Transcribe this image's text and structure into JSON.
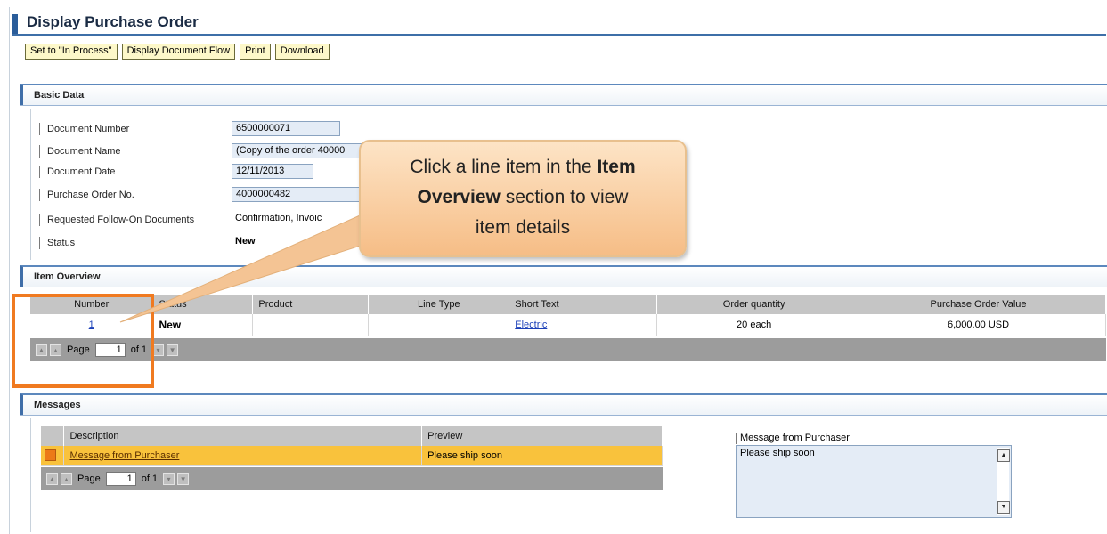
{
  "page": {
    "title": "Display Purchase Order"
  },
  "toolbar": {
    "set_in_process": "Set to \"In Process\"",
    "display_doc_flow": "Display Document Flow",
    "print": "Print",
    "download": "Download"
  },
  "basic_data": {
    "heading": "Basic Data",
    "fields": [
      {
        "label": "Document Number",
        "value": "6500000071"
      },
      {
        "label": "Document Name",
        "value": "(Copy of the order 40000"
      },
      {
        "label": "Document Date",
        "value": "12/11/2013"
      },
      {
        "label": "Purchase Order No.",
        "value": "4000000482"
      },
      {
        "label": "Requested Follow-On Documents",
        "value": "Confirmation, Invoic"
      },
      {
        "label": "Status",
        "value": "New"
      }
    ]
  },
  "item_overview": {
    "heading": "Item Overview",
    "columns": [
      "Number",
      "Status",
      "Product",
      "Line Type",
      "Short Text",
      "Order quantity",
      "Purchase Order Value"
    ],
    "rows": [
      {
        "number": "1",
        "status": "New",
        "product": "",
        "line_type": "",
        "short_text": "Electric",
        "order_quantity": "20 each",
        "po_value": "6,000.00 USD"
      }
    ],
    "pager": {
      "page_label": "Page",
      "current": "1",
      "of_label": "of 1"
    }
  },
  "callout": {
    "line1_pre": "Click a line item in the ",
    "line1_bold": "Item",
    "line2_bold": "Overview",
    "line2_post": " section to view",
    "line3": "item details"
  },
  "messages": {
    "heading": "Messages",
    "columns": [
      "Description",
      "Preview"
    ],
    "rows": [
      {
        "description": "Message from Purchaser",
        "preview": "Please ship soon"
      }
    ],
    "pager": {
      "page_label": "Page",
      "current": "1",
      "of_label": "of 1"
    },
    "detail_label": "Message from Purchaser",
    "detail_text": "Please ship soon"
  },
  "colors": {
    "highlight": "#f07a20",
    "callout_bg": "#f6bd86",
    "selected_row": "#f9c23c",
    "header_blue": "#2a5d9a"
  }
}
